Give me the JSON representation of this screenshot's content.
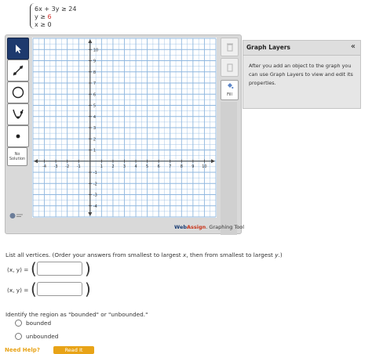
{
  "system": {
    "lines": [
      {
        "lhs": "6x + 3y ≥ ",
        "rhs": "24",
        "rhs_color": "#333333"
      },
      {
        "lhs": "y ≥ ",
        "rhs": "6",
        "rhs_color": "#d0312d"
      },
      {
        "lhs": "x ≥ ",
        "rhs": "0",
        "rhs_color": "#333333"
      }
    ]
  },
  "toolbar": {
    "tools": [
      {
        "name": "pointer-tool",
        "icon": "pointer-icon",
        "selected": true
      },
      {
        "name": "line-tool",
        "icon": "line-icon",
        "selected": false
      },
      {
        "name": "circle-tool",
        "icon": "circle-icon",
        "selected": false
      },
      {
        "name": "parabola-tool",
        "icon": "parabola-icon",
        "selected": false
      },
      {
        "name": "point-tool",
        "icon": "point-icon",
        "selected": false
      }
    ],
    "no_solution_line1": "No",
    "no_solution_line2": "Solution"
  },
  "graph": {
    "x_ticks": [
      "-4",
      "-3",
      "-2",
      "-1",
      "1",
      "2",
      "3",
      "4",
      "5",
      "6",
      "7",
      "8",
      "9",
      "10"
    ],
    "y_ticks": [
      "10",
      "9",
      "8",
      "7",
      "6",
      "5",
      "4",
      "3",
      "2",
      "1",
      "-1",
      "-2",
      "-3",
      "-4"
    ],
    "xmin": -5,
    "xmax": 11,
    "ymin": -5,
    "ymax": 11,
    "grid": true
  },
  "side_buttons": {
    "fill_label": "Fill",
    "fill_icon": "paint-bucket-icon"
  },
  "branding": {
    "web": "Web",
    "assign": "Assign",
    "suffix": ". Graphing Tool"
  },
  "layers_panel": {
    "title": "Graph Layers",
    "collapse": "«",
    "body": "After you add an object to the graph you can use Graph Layers to view and edit its properties."
  },
  "questions": {
    "vertices_prompt_a": "List all vertices. (Order your answers from smallest to largest ",
    "vertices_prompt_x": "x",
    "vertices_prompt_b": ", then from smallest to largest ",
    "vertices_prompt_y": "y",
    "vertices_prompt_c": ".)",
    "xy_label": "(x, y) =",
    "answer1": "",
    "answer2": "",
    "region_prompt": "Identify the region as \"bounded\" or \"unbounded.\"",
    "options": [
      "bounded",
      "unbounded"
    ],
    "need_help": "Need Help?",
    "read_it": "Read It"
  },
  "colors": {
    "accent_blue": "#1e3a6e",
    "grid_line": "#8fb7df",
    "axis": "#444444",
    "red": "#d0312d",
    "help_orange": "#e8a317"
  }
}
